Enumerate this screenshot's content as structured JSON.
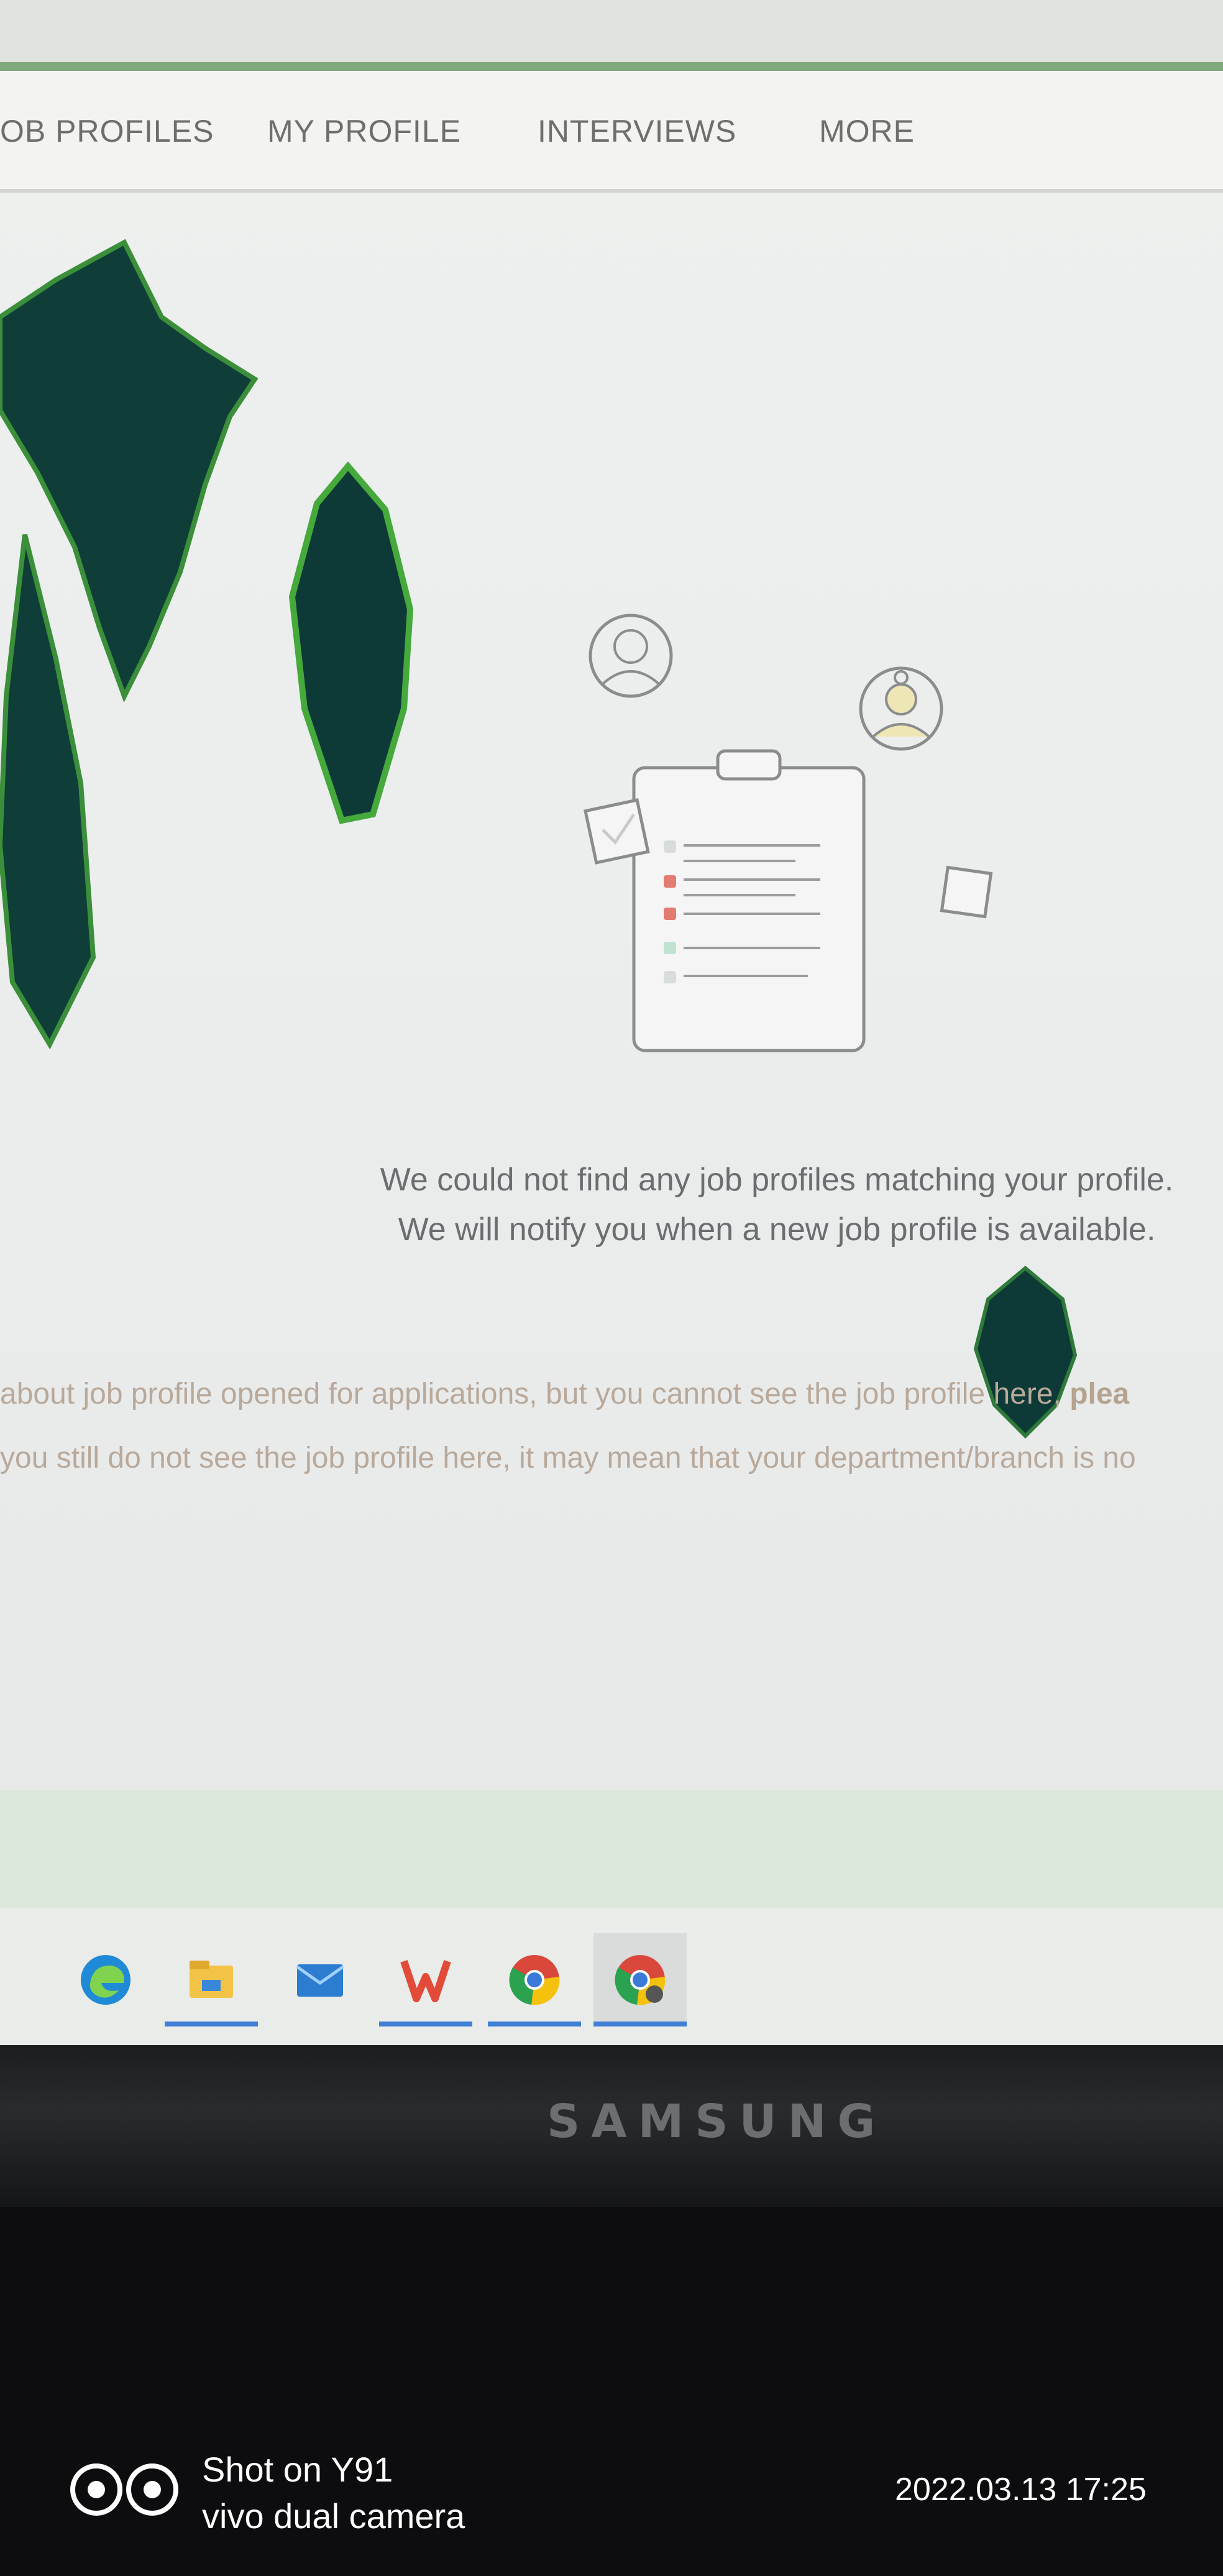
{
  "nav": {
    "items": [
      {
        "label": "JOB PROFILES",
        "visible_text": "OB PROFILES"
      },
      {
        "label": "MY PROFILE"
      },
      {
        "label": "INTERVIEWS"
      },
      {
        "label": "MORE"
      }
    ]
  },
  "empty_state": {
    "line1": "We could not find any job profiles matching your profile.",
    "line2": "We will notify you when a new job profile is available."
  },
  "notice": {
    "line1_prefix": "about job profile opened for applications, but you cannot see the job profile here, ",
    "line1_bold": "plea",
    "line2": "you still do not see the job profile here, it may mean that your department/branch is no"
  },
  "taskbar": {
    "apps": [
      {
        "icon": "edge-icon"
      },
      {
        "icon": "file-explorer-icon"
      },
      {
        "icon": "mail-icon"
      },
      {
        "icon": "wps-office-icon"
      },
      {
        "icon": "chrome-icon"
      },
      {
        "icon": "chrome-profile-icon"
      }
    ]
  },
  "monitor": {
    "brand": "SAMSUNG"
  },
  "camera_watermark": {
    "line1": "Shot on Y91",
    "line2": "vivo dual camera",
    "timestamp": "2022.03.13 17:25"
  }
}
